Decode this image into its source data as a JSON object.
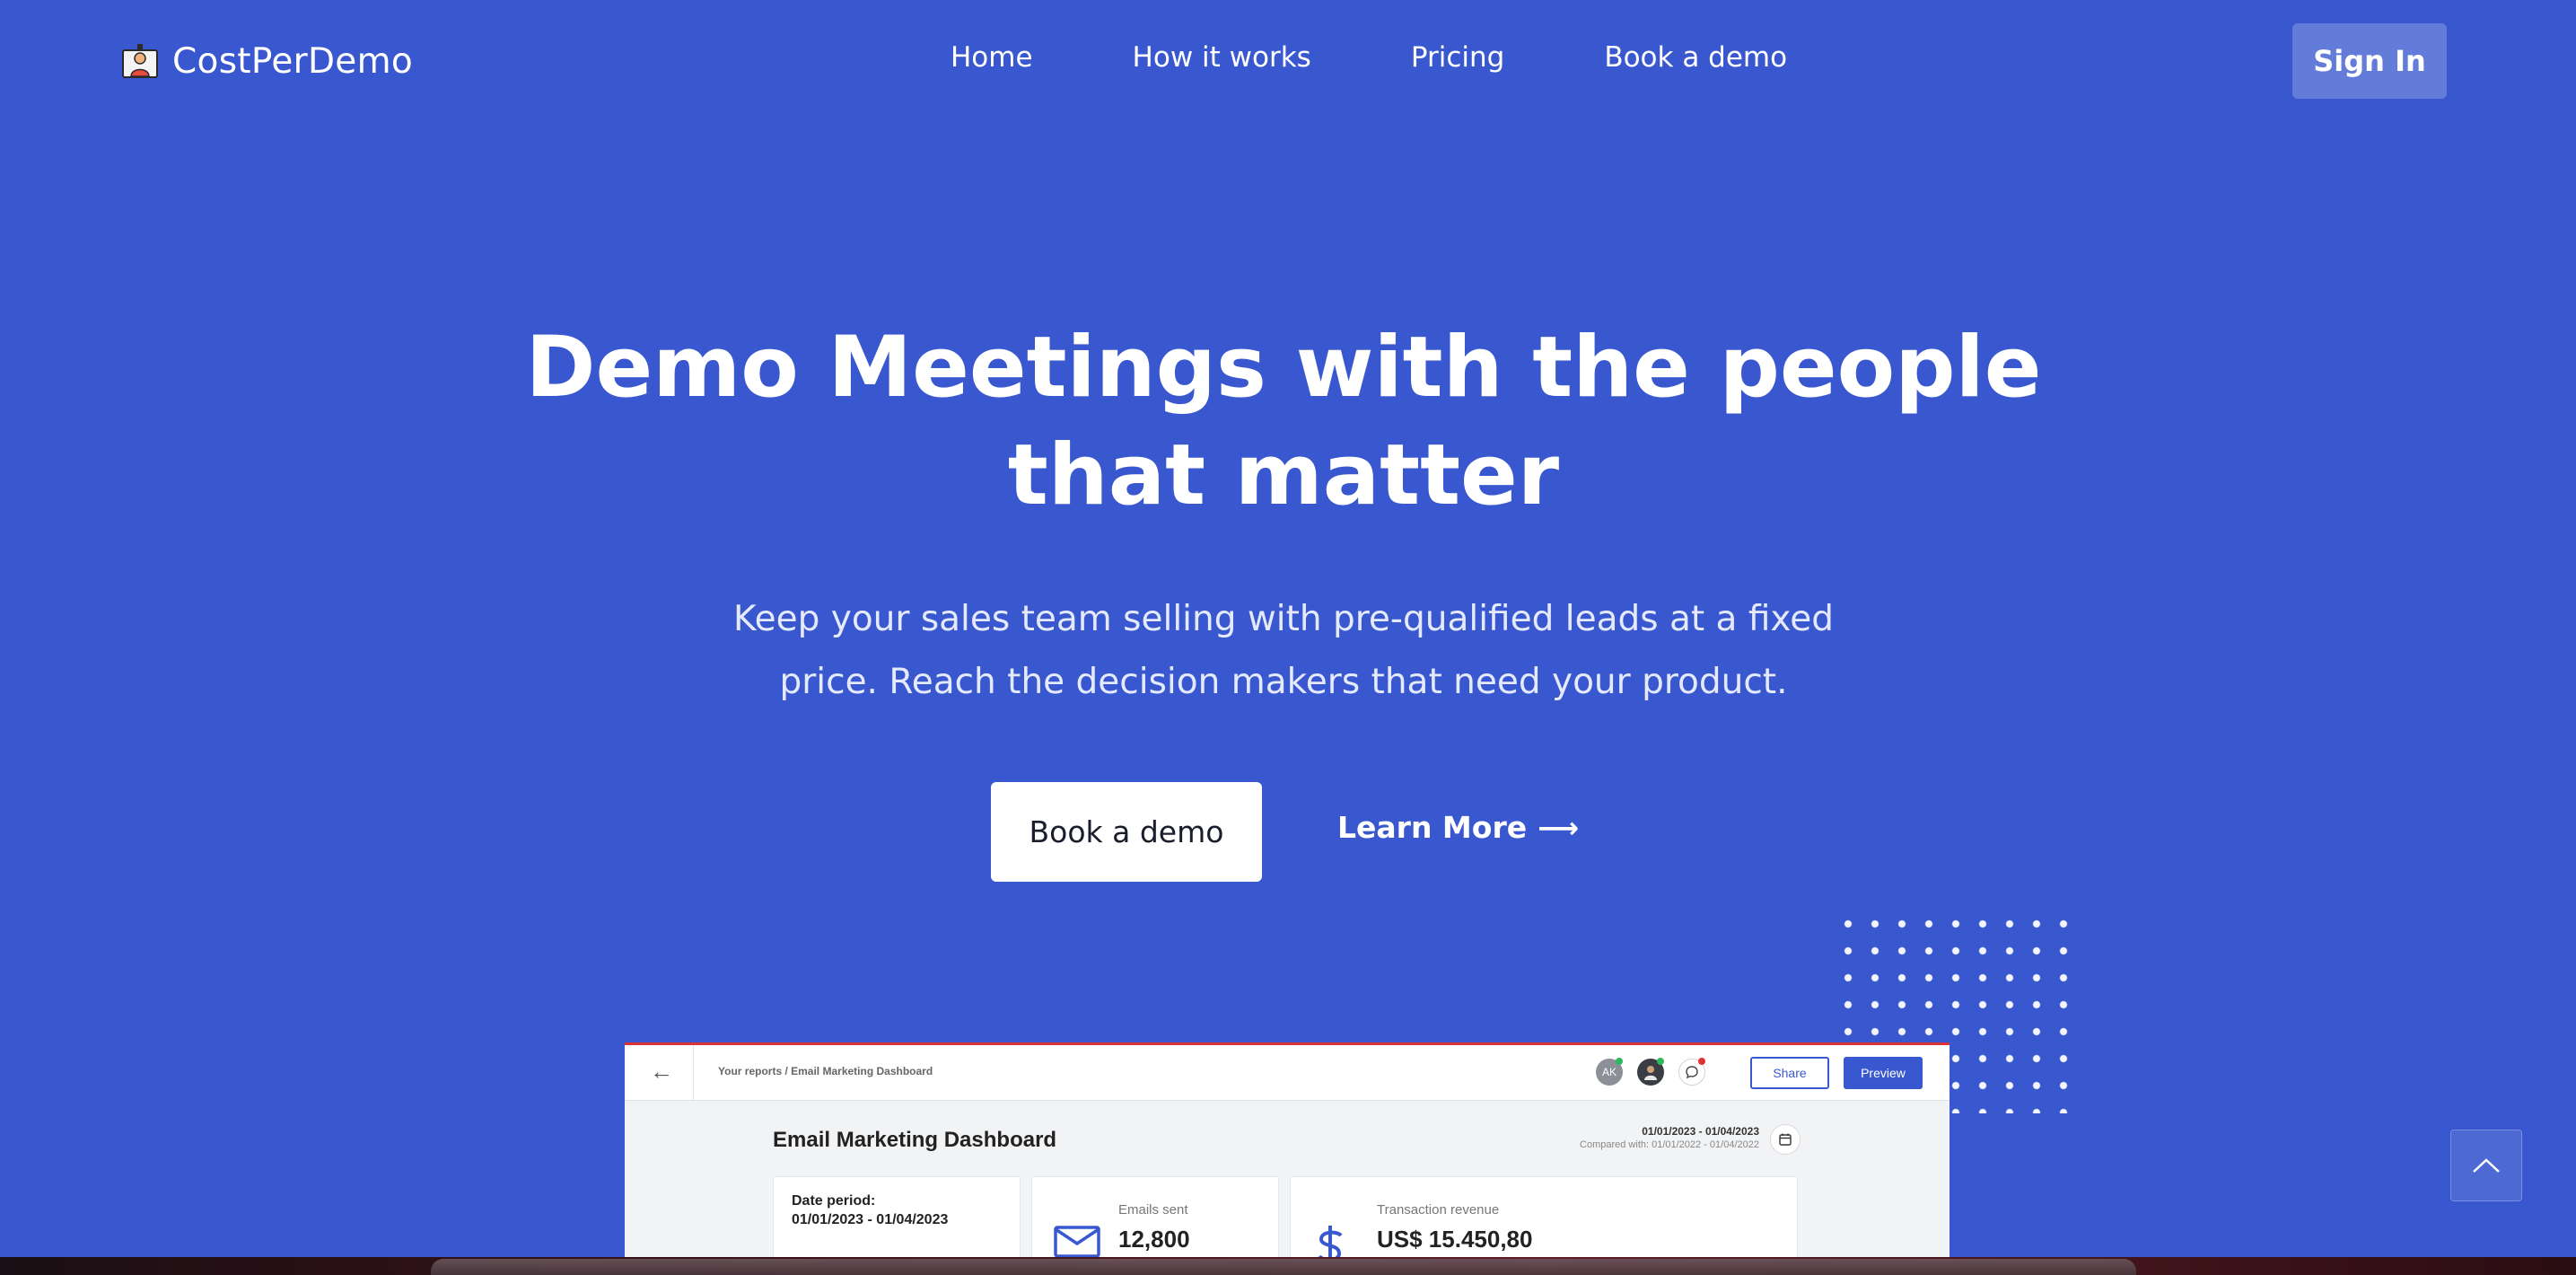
{
  "nav": {
    "logo_text": "CostPerDemo",
    "links": [
      "Home",
      "How it works",
      "Pricing",
      "Book a demo"
    ],
    "signin_label": "Sign In"
  },
  "hero": {
    "title_line1": "Demo Meetings with the people",
    "title_line2": "that matter",
    "subtitle_line1": "Keep your sales team selling with pre-qualified leads at a fixed",
    "subtitle_line2": "price. Reach the decision makers that need your product.",
    "primary_cta": "Book a demo",
    "secondary_cta": "Learn More",
    "secondary_arrow": "⟶"
  },
  "preview": {
    "back_icon": "←",
    "breadcrumb": "Your reports / Email Marketing Dashboard",
    "avatar_initials": "AK",
    "share_label": "Share",
    "preview_label": "Preview",
    "title": "Email Marketing Dashboard",
    "date_range": "01/01/2023 - 01/04/2023",
    "compared_with": "Compared with: 01/01/2022 - 01/04/2022",
    "date_period_label": "Date period:",
    "date_period_value": "01/01/2023 - 01/04/2023",
    "kpi_emails_label": "Emails sent",
    "kpi_emails_value": "12,800",
    "kpi_revenue_label": "Transaction revenue",
    "kpi_revenue_value": "US$ 15.450,80"
  },
  "colors": {
    "brand_blue": "#3958cf",
    "white": "#ffffff"
  },
  "icons": {
    "logo": "presenter-icon",
    "scroll_top": "chevron-up-icon",
    "calendar": "calendar-icon",
    "email": "envelope-icon",
    "revenue": "dollar-icon"
  }
}
